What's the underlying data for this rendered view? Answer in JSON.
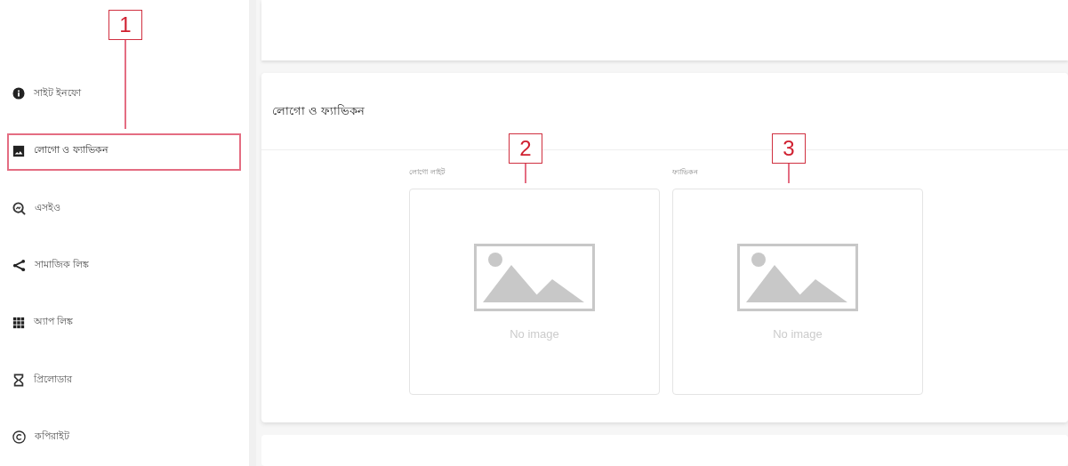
{
  "sidebar": {
    "items": [
      {
        "kind": "info",
        "label": "সাইট ইনফো",
        "selected": false
      },
      {
        "kind": "image",
        "label": "লোগো ও ফ্যাভিকন",
        "selected": true,
        "callout": "1"
      },
      {
        "kind": "seo",
        "label": "এসইও",
        "selected": false
      },
      {
        "kind": "share",
        "label": "সামাজিক লিঙ্ক",
        "selected": false
      },
      {
        "kind": "grid",
        "label": "অ্যাপ লিঙ্ক",
        "selected": false
      },
      {
        "kind": "hourglass",
        "label": "প্রিলোডার",
        "selected": false
      },
      {
        "kind": "copyright",
        "label": "কপিরাইট",
        "selected": false
      }
    ]
  },
  "card": {
    "title": "লোগো ও ফ্যাভিকন",
    "uploads": [
      {
        "label": "লোগো লাইট",
        "empty_text": "No image",
        "callout": "2"
      },
      {
        "label": "ফ্যাভিকন",
        "empty_text": "No image",
        "callout": "3"
      }
    ]
  }
}
